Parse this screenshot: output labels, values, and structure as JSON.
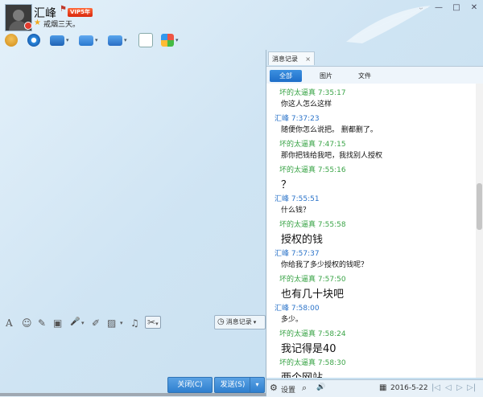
{
  "header": {
    "contact_name": "汇峰",
    "vip_label": "VIP5年",
    "signature": "戒烟三天。"
  },
  "icons": {
    "star": "★",
    "flag": "⚑",
    "minimize": "—",
    "maximize": "□",
    "close": "✕",
    "expand": "⌄",
    "mic": "🎙",
    "caret": "▾",
    "font": "A",
    "emoji": "☺",
    "magic": "✎",
    "screenshot": "▣",
    "voice": "🎤",
    "edit": "✐",
    "image": "▨",
    "music": "♫",
    "scissors": "✂",
    "clock": "◷",
    "settings": "⚙",
    "search": "⌕",
    "speaker": "🔊",
    "calendar": "▦",
    "first": "|◁",
    "prev": "◁",
    "next": "▷",
    "last": "▷|",
    "tab_close": "×"
  },
  "input_toolbar": {
    "history_label": "消息记录"
  },
  "buttons": {
    "close": "关闭(C)",
    "send": "发送(S)"
  },
  "panel": {
    "tab_title": "消息记录",
    "filters": [
      "全部",
      "图片",
      "文件"
    ],
    "footer_settings": "设置",
    "footer_date": "2016-5-22"
  },
  "messages": [
    {
      "sender": "坏的太逼真",
      "time": "7:35:17",
      "text": "你这人怎么这样",
      "type": "peer",
      "size": "small"
    },
    {
      "sender": "汇峰",
      "time": "7:37:23",
      "text": "随便你怎么说把。   删都删了。",
      "type": "self",
      "size": "small"
    },
    {
      "sender": "坏的太逼真",
      "time": "7:47:15",
      "text": "那你把钱给我吧，我找别人授权",
      "type": "peer",
      "size": "small"
    },
    {
      "sender": "坏的太逼真",
      "time": "7:55:16",
      "text": "？",
      "type": "peer",
      "size": "large"
    },
    {
      "sender": "汇峰",
      "time": "7:55:51",
      "text": "什么钱？",
      "type": "self",
      "size": "small"
    },
    {
      "sender": "坏的太逼真",
      "time": "7:55:58",
      "text": "授权的钱",
      "type": "peer",
      "size": "large"
    },
    {
      "sender": "汇峰",
      "time": "7:57:37",
      "text": "你给我了多少授权的钱呢？",
      "type": "self",
      "size": "small"
    },
    {
      "sender": "坏的太逼真",
      "time": "7:57:50",
      "text": "也有几十块吧",
      "type": "peer",
      "size": "large"
    },
    {
      "sender": "汇峰",
      "time": "7:58:00",
      "text": "多少。",
      "type": "self",
      "size": "small"
    },
    {
      "sender": "坏的太逼真",
      "time": "7:58:24",
      "text": "我记得是40",
      "type": "peer",
      "size": "large"
    },
    {
      "sender": "坏的太逼真",
      "time": "7:58:30",
      "text": "两个网站",
      "type": "peer",
      "size": "large"
    }
  ],
  "colors": {
    "accent": "#2f7fcf",
    "peer_name": "#3aa447",
    "self_name": "#2a73c9"
  }
}
